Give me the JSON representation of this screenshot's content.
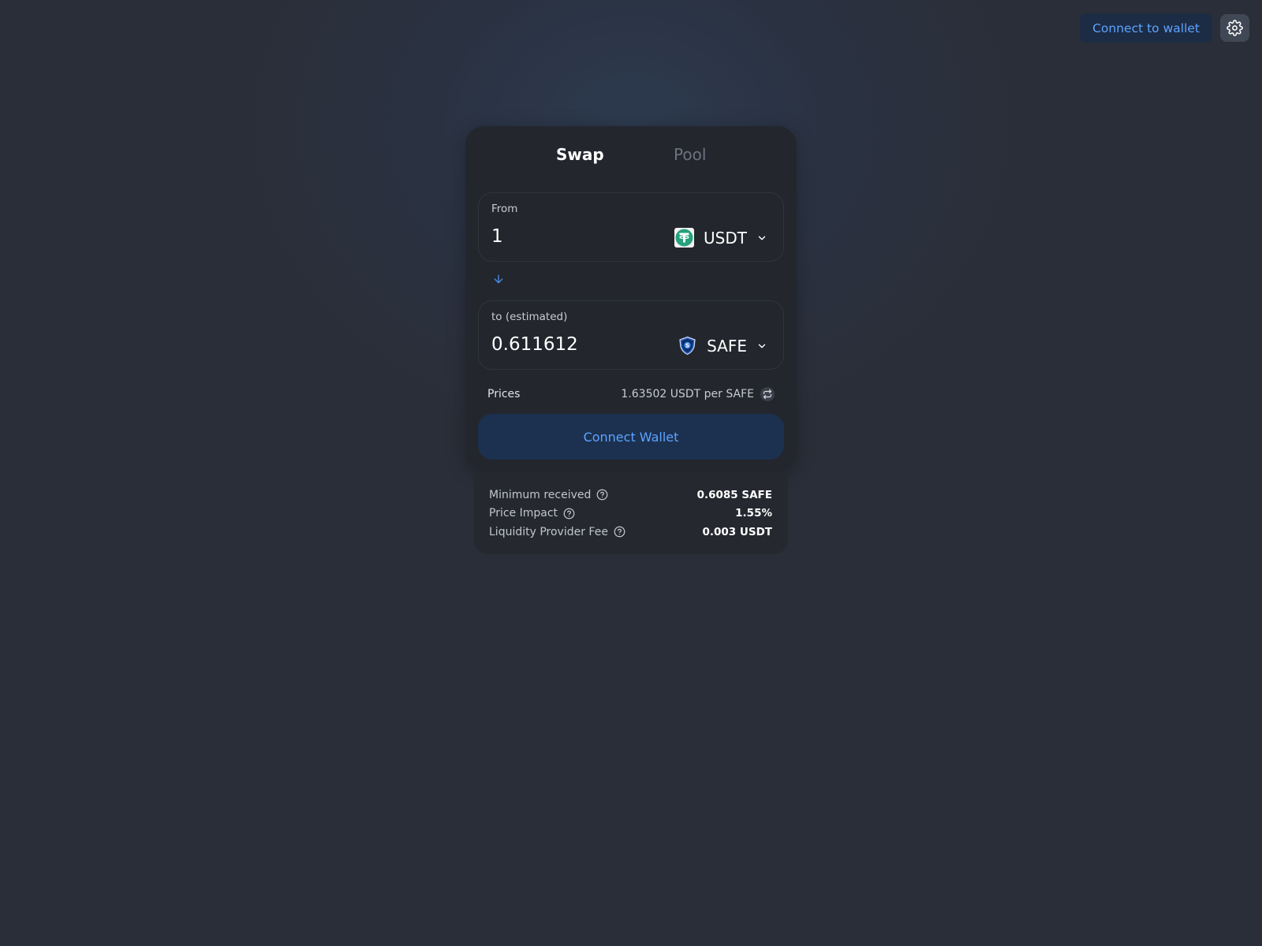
{
  "header": {
    "connect_label": "Connect to wallet",
    "settings_icon": "gear-icon"
  },
  "tabs": [
    {
      "label": "Swap",
      "active": true
    },
    {
      "label": "Pool",
      "active": false
    }
  ],
  "from": {
    "label": "From",
    "amount": "1",
    "token": {
      "symbol": "USDT",
      "icon": "usdt-token-icon",
      "color": "#26a17b"
    }
  },
  "to": {
    "label": "to (estimated)",
    "amount": "0.611612",
    "token": {
      "symbol": "SAFE",
      "icon": "safe-token-icon",
      "color": "#1e5ab8"
    }
  },
  "prices": {
    "label": "Prices",
    "value": "1.63502 USDT per SAFE"
  },
  "connect_button": {
    "label": "Connect Wallet"
  },
  "details": [
    {
      "label": "Minimum received",
      "value": "0.6085 SAFE"
    },
    {
      "label": "Price Impact",
      "value": "1.55%"
    },
    {
      "label": "Liquidity Provider Fee",
      "value": "0.003 USDT"
    }
  ],
  "colors": {
    "accent": "#5da3ff",
    "button_bg": "#1c3150",
    "card_bg": "#23262d",
    "page_bg": "#2a2e38"
  }
}
